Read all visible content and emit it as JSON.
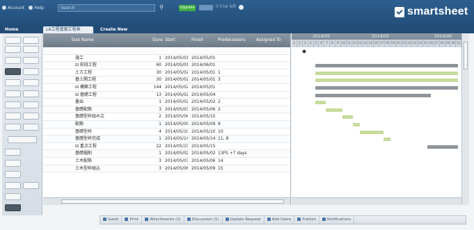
{
  "topbar": {
    "nav": [
      "Account",
      "Help"
    ],
    "search_placeholder": "Search",
    "upgrade_label": "Upgrade",
    "trial_text": "0 trial left",
    "brand": "smartsheet"
  },
  "tabs": {
    "home": "Home",
    "sheet": "LA工程進度工程表",
    "create": "Create New"
  },
  "grid": {
    "columns": {
      "task": "Task Name",
      "duration": "Dura",
      "start": "Start",
      "finish": "Finish",
      "predecessors": "Predecessors",
      "assigned": "Assigned To"
    },
    "rows": [
      {
        "num": "",
        "task": "",
        "dur": "",
        "start": "",
        "end": "",
        "pred": ""
      },
      {
        "num": "",
        "task": "施工",
        "dur": "1",
        "start": "2014/05/01",
        "end": "2014/05/01",
        "pred": ""
      },
      {
        "num": "",
        "task": "⊟ 前段工程",
        "dur": "60",
        "start": "2014/05/01",
        "end": "2014/06/01",
        "pred": ""
      },
      {
        "num": "",
        "task": "土方工程",
        "dur": "30",
        "start": "2014/05/02",
        "end": "2014/05/01",
        "pred": "1"
      },
      {
        "num": "",
        "task": "基土開工程",
        "dur": "30",
        "start": "2014/05/02",
        "end": "2014/05/01",
        "pred": "3"
      },
      {
        "num": "",
        "task": "⊟ 構築工程",
        "dur": "144",
        "start": "2014/05/02",
        "end": "2014/05/01",
        "pred": ""
      },
      {
        "num": "",
        "task": "⊟ 基礎工程",
        "dur": "13",
        "start": "2014/05/02",
        "end": "2014/05/04",
        "pred": ""
      },
      {
        "num": "",
        "task": "墨出",
        "dur": "1",
        "start": "2014/05/02",
        "end": "2014/05/02",
        "pred": "2"
      },
      {
        "num": "",
        "task": "基礎配筋",
        "dur": "3",
        "start": "2014/05/03",
        "end": "2014/05/06",
        "pred": "2"
      },
      {
        "num": "",
        "task": "基礎型枠組み立",
        "dur": "2",
        "start": "2014/05/06",
        "end": "2014/05/10",
        "pred": ""
      },
      {
        "num": "",
        "task": "配筋",
        "dur": "1",
        "start": "2014/05/09",
        "end": "2014/05/09",
        "pred": "8"
      },
      {
        "num": "",
        "task": "基礎型枠",
        "dur": "4",
        "start": "2014/05/10",
        "end": "2014/05/10",
        "pred": "10"
      },
      {
        "num": "",
        "task": "基礎型枠完成",
        "dur": "1",
        "start": "2014/05/14",
        "end": "2014/05/14",
        "pred": "11, 8"
      },
      {
        "num": "",
        "task": "⊟ 重点工程",
        "dur": "22",
        "start": "2014/05/15",
        "end": "2014/05/15",
        "pred": ""
      },
      {
        "num": "",
        "task": "基礎掘削",
        "dur": "1",
        "start": "2014/05/02",
        "end": "2014/05/02",
        "pred": "13FS +7 days"
      },
      {
        "num": "",
        "task": "土木配筋",
        "dur": "3",
        "start": "2014/05/03",
        "end": "2014/05/06",
        "pred": "14"
      },
      {
        "num": "",
        "task": "土木型枠組込",
        "dur": "3",
        "start": "2014/05/06",
        "end": "2014/05/09",
        "pred": "15"
      }
    ]
  },
  "gantt": {
    "months": [
      "2014/05",
      "2014/05",
      "2014/06"
    ],
    "tick_labels": [
      "1",
      "2",
      "3",
      "4",
      "5",
      "6",
      "7",
      "8",
      "9",
      "10",
      "11",
      "12",
      "13",
      "14",
      "15",
      "16",
      "17",
      "18",
      "19",
      "20",
      "21",
      "22",
      "23",
      "24",
      "25",
      "26",
      "27",
      "28",
      "29",
      "30",
      "31"
    ],
    "bars": [
      {
        "row": 0,
        "type": "milestone",
        "start": 0.06,
        "end": 0.06
      },
      {
        "row": 2,
        "type": "parent",
        "start": 0.14,
        "end": 0.98
      },
      {
        "row": 3,
        "type": "task",
        "start": 0.14,
        "end": 0.98
      },
      {
        "row": 4,
        "type": "task",
        "start": 0.14,
        "end": 0.98
      },
      {
        "row": 5,
        "type": "parent",
        "start": 0.14,
        "end": 0.98
      },
      {
        "row": 6,
        "type": "parent",
        "start": 0.14,
        "end": 0.82
      },
      {
        "row": 7,
        "type": "task",
        "start": 0.14,
        "end": 0.2
      },
      {
        "row": 8,
        "type": "task",
        "start": 0.2,
        "end": 0.3
      },
      {
        "row": 9,
        "type": "task",
        "start": 0.3,
        "end": 0.36
      },
      {
        "row": 10,
        "type": "task",
        "start": 0.36,
        "end": 0.4
      },
      {
        "row": 11,
        "type": "task",
        "start": 0.4,
        "end": 0.54
      },
      {
        "row": 12,
        "type": "task",
        "start": 0.54,
        "end": 0.58
      },
      {
        "row": 13,
        "type": "parent",
        "start": 0.8,
        "end": 0.98
      }
    ]
  },
  "bottombar": {
    "items": [
      "Gantt",
      "Print",
      "Attachments (1)",
      "Discussion (1)",
      "Update Request",
      "Add Users",
      "Publish",
      "Notifications"
    ]
  },
  "colors": {
    "topbar": "#2a5a89",
    "parent_bar": "#8e9499",
    "task_bar": "#c6dc9c",
    "brand_white": "#ffffff"
  }
}
